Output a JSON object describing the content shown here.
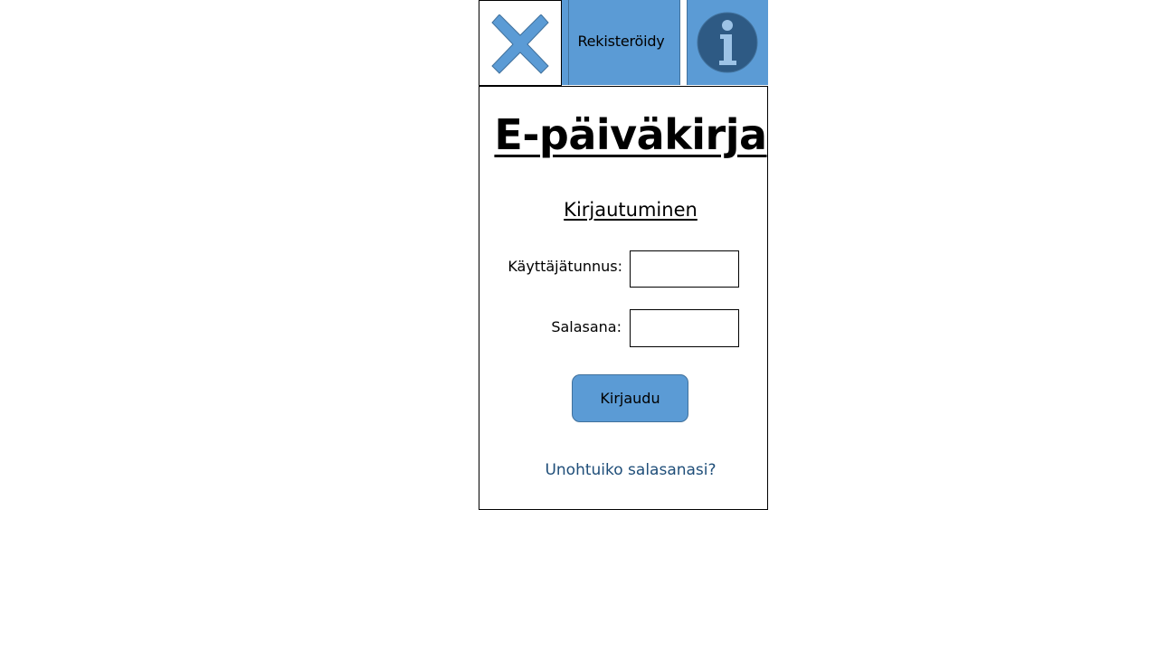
{
  "topbar": {
    "close_icon": "close-x-icon",
    "register_label": "Rekisteröidy",
    "info_icon": "info-icon"
  },
  "main": {
    "title": "E-päiväkirja",
    "subtitle": "Kirjautuminen",
    "username_label": "Käyttäjätunnus:",
    "username_value": "",
    "password_label": "Salasana:",
    "password_value": "",
    "login_label": "Kirjaudu",
    "forgot_label": "Unohtuiko salasanasi?"
  },
  "colors": {
    "accent": "#5b9bd5",
    "accent_border": "#41719c",
    "info_circle": "#2e5a84",
    "info_glyph": "#9dc3e6",
    "link": "#1f4e79"
  }
}
